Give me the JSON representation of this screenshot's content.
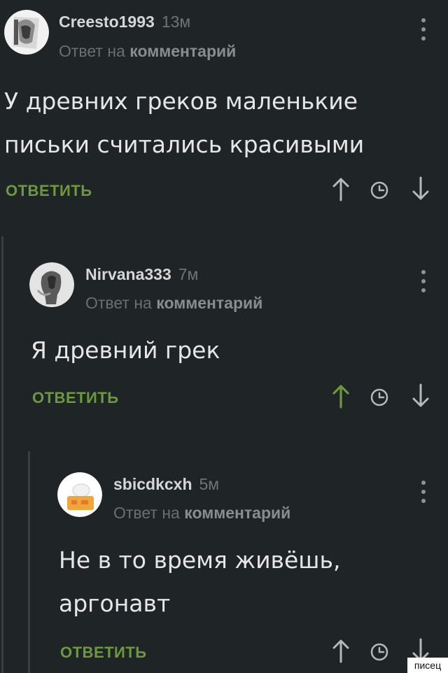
{
  "comments": [
    {
      "username": "Creesto1993",
      "time": "13м",
      "reply_prefix": "Ответ на",
      "reply_target": "комментарий",
      "body_lines": [
        "У древних греков маленькие",
        "письки считались красивыми"
      ],
      "reply_label": "ОТВЕТИТЬ",
      "upvoted": false
    },
    {
      "username": "Nirvana333",
      "time": "7м",
      "reply_prefix": "Ответ на",
      "reply_target": "комментарий",
      "body_lines": [
        "Я древний грек"
      ],
      "reply_label": "ОТВЕТИТЬ",
      "upvoted": true
    },
    {
      "username": "sbicdkcxh",
      "time": "5м",
      "reply_prefix": "Ответ на",
      "reply_target": "комментарий",
      "body_lines": [
        "Не в то время живёшь,",
        "аргонавт"
      ],
      "reply_label": "ОТВЕТИТЬ",
      "upvoted": false
    }
  ],
  "icons": [
    "avatar",
    "more-vertical-icon",
    "upvote-arrow-icon",
    "clock-icon",
    "downvote-arrow-icon"
  ],
  "colors": {
    "background": "#1f2426",
    "accent_green": "#6b9a3a",
    "arrow_default": "#b5b9bb"
  },
  "watermark": "писец"
}
